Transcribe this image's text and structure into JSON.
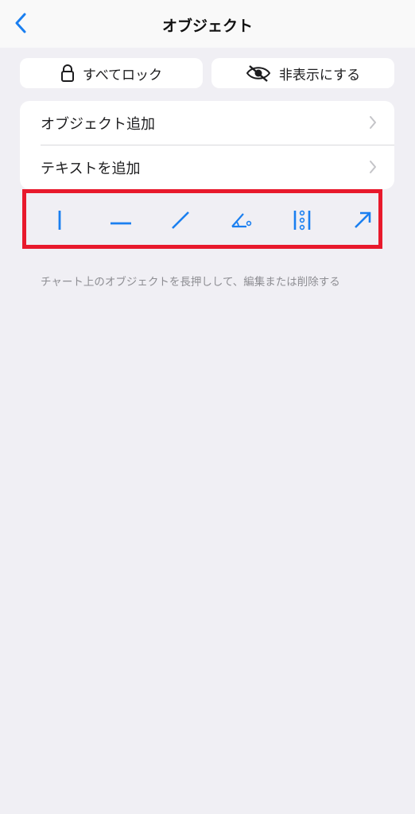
{
  "header": {
    "title": "オブジェクト",
    "back_icon": "chevron-left-icon"
  },
  "actions": {
    "lock_all": {
      "label": "すべてロック",
      "icon": "lock-icon"
    },
    "hide": {
      "label": "非表示にする",
      "icon": "eye-slash-icon"
    }
  },
  "menu": {
    "items": [
      {
        "label": "オブジェクト追加",
        "icon": "chevron-right-icon"
      },
      {
        "label": "テキストを追加",
        "icon": "chevron-right-icon"
      }
    ]
  },
  "tools": [
    {
      "icon": "vertical-line-icon"
    },
    {
      "icon": "horizontal-line-icon"
    },
    {
      "icon": "trend-line-icon"
    },
    {
      "icon": "angle-tool-icon"
    },
    {
      "icon": "vertical-dots-tool-icon"
    },
    {
      "icon": "arrow-tool-icon"
    }
  ],
  "hint": "チャート上のオブジェクトを長押しして、編集または削除する",
  "colors": {
    "accent": "#1a7ff0",
    "highlight_frame": "#e8192c",
    "background": "#f0eff4"
  }
}
